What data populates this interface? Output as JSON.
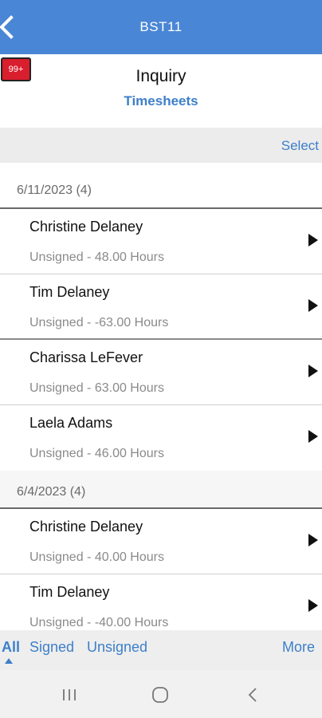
{
  "topbar": {
    "title": "BST11",
    "back_icon": "chevron-left-icon"
  },
  "header": {
    "badge": "99+",
    "title": "Inquiry",
    "subtitle": "Timesheets"
  },
  "toolbar": {
    "select_label": "Select"
  },
  "groups": [
    {
      "header": "6/11/2023 (4)",
      "items": [
        {
          "name": "Christine Delaney",
          "detail": "Unsigned - 48.00 Hours"
        },
        {
          "name": "Tim Delaney",
          "detail": "Unsigned - -63.00 Hours"
        },
        {
          "name": "Charissa LeFever",
          "detail": "Unsigned - 63.00 Hours"
        },
        {
          "name": "Laela Adams",
          "detail": "Unsigned - 46.00 Hours"
        }
      ]
    },
    {
      "header": "6/4/2023 (4)",
      "items": [
        {
          "name": "Christine Delaney",
          "detail": "Unsigned - 40.00 Hours"
        },
        {
          "name": "Tim Delaney",
          "detail": "Unsigned - -40.00 Hours"
        }
      ]
    }
  ],
  "filters": {
    "all": "All",
    "signed": "Signed",
    "unsigned": "Unsigned",
    "more": "More",
    "active": "All"
  },
  "colors": {
    "accent": "#4a86d6",
    "link": "#3d7fc9",
    "badge": "#d91e2d"
  }
}
